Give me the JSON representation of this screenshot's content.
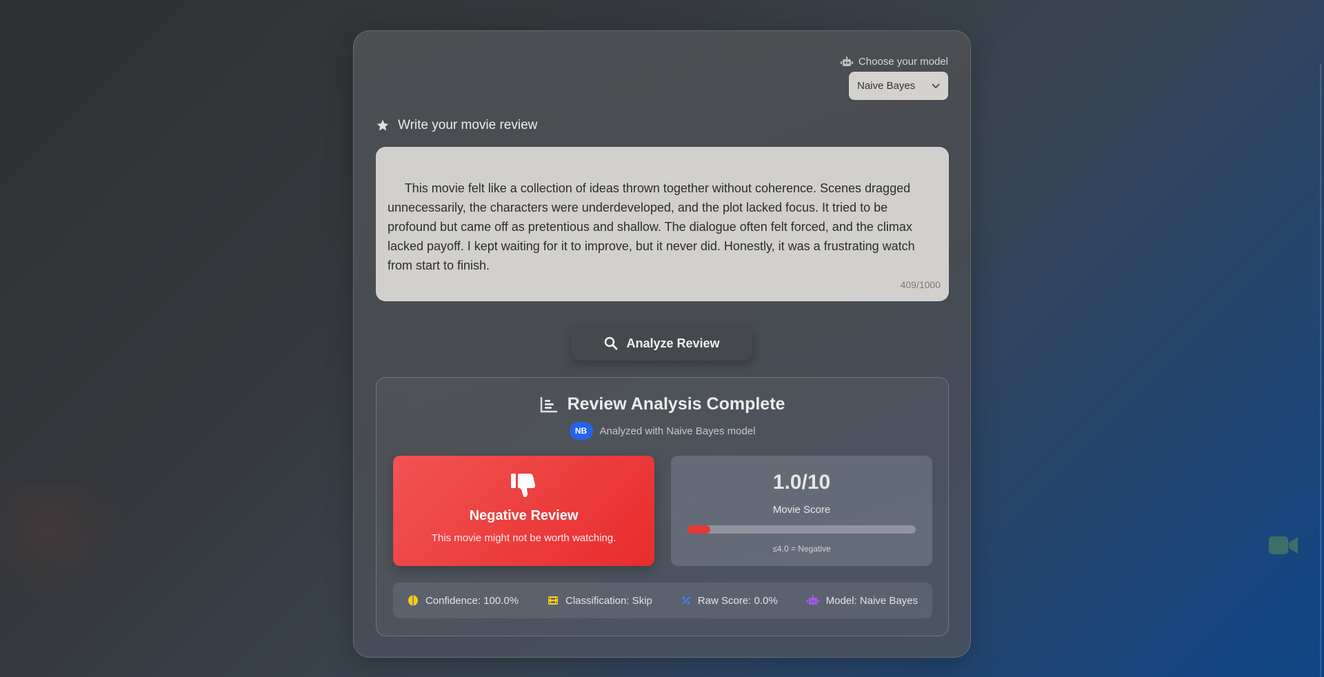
{
  "model_picker": {
    "label": "Choose your model",
    "selected": "Naive Bayes"
  },
  "review": {
    "heading": "Write your movie review",
    "text": " This movie felt like a collection of ideas thrown together without coherence. Scenes dragged unnecessarily, the characters were underdeveloped, and the plot lacked focus. It tried to be profound but came off as pretentious and shallow. The dialogue often felt forced, and the climax lacked payoff. I kept waiting for it to improve, but it never did. Honestly, it was a frustrating watch from start to finish.",
    "char_count": "409/1000"
  },
  "analyze_button": {
    "label": "Analyze Review"
  },
  "results": {
    "title": "Review Analysis Complete",
    "model_badge": "NB",
    "subtitle": "Analyzed with Naive Bayes model",
    "verdict": {
      "title": "Negative Review",
      "description": "This movie might not be worth watching.",
      "color": "#ef4444"
    },
    "score": {
      "value": "1.0/10",
      "label": "Movie Score",
      "fraction": 0.1,
      "note": "≤4.0 = Negative"
    },
    "stats": [
      {
        "text": "Confidence: 100.0%",
        "icon": "brain-icon"
      },
      {
        "text": "Classification: Skip",
        "icon": "film-icon"
      },
      {
        "text": "Raw Score: 0.0%",
        "icon": "percent-icon"
      },
      {
        "text": "Model: Naive Bayes",
        "icon": "robot-icon"
      }
    ]
  }
}
